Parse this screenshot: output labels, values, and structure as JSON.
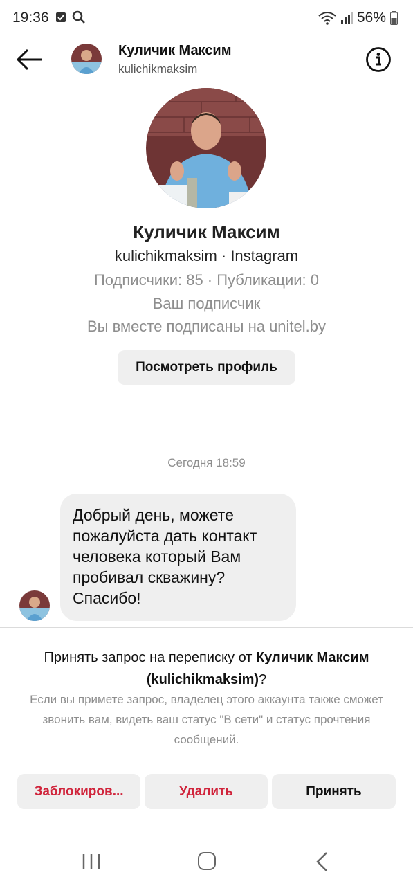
{
  "status_bar": {
    "time": "19:36",
    "left_icons": [
      "checkbox-notification-icon",
      "search-notification-icon"
    ],
    "right_icons": [
      "wifi-icon",
      "signal-icon"
    ],
    "battery": "56%"
  },
  "header": {
    "name": "Куличик Максим",
    "username": "kulichikmaksim",
    "back_icon": "arrow-left-icon",
    "info_icon": "info-circle-icon"
  },
  "profile": {
    "name": "Куличик Максим",
    "subtitle": "kulichikmaksim · Instagram",
    "stats": "Подписчики: 85 · Публикации: 0",
    "follow_status": "Ваш подписчик",
    "mutual": "Вы вместе подписаны на unitel.by",
    "view_profile_label": "Посмотреть профиль"
  },
  "chat": {
    "timestamp": "Сегодня 18:59",
    "message_lines": [
      "Добрый день, можете",
      "пожалуйста дать контакт",
      "человека который Вам",
      "пробивал скважину?",
      "Спасибо!"
    ]
  },
  "request": {
    "title_prefix": "Принять запрос на переписку от ",
    "title_name": "Куличик Максим",
    "title_username": "(kulichikmaksim)",
    "title_suffix": "?",
    "description": "Если вы примете запрос, владелец этого аккаунта также сможет звонить вам, видеть ваш статус \"В сети\" и статус прочтения сообщений.",
    "block_label": "Заблокиров...",
    "delete_label": "Удалить",
    "accept_label": "Принять"
  },
  "nav_bar": {
    "icons": [
      "recent-apps-icon",
      "home-icon",
      "back-icon"
    ]
  },
  "colors": {
    "danger": "#d0243b",
    "secondary_text": "#8e8e8e",
    "bubble_bg": "#efefef"
  }
}
